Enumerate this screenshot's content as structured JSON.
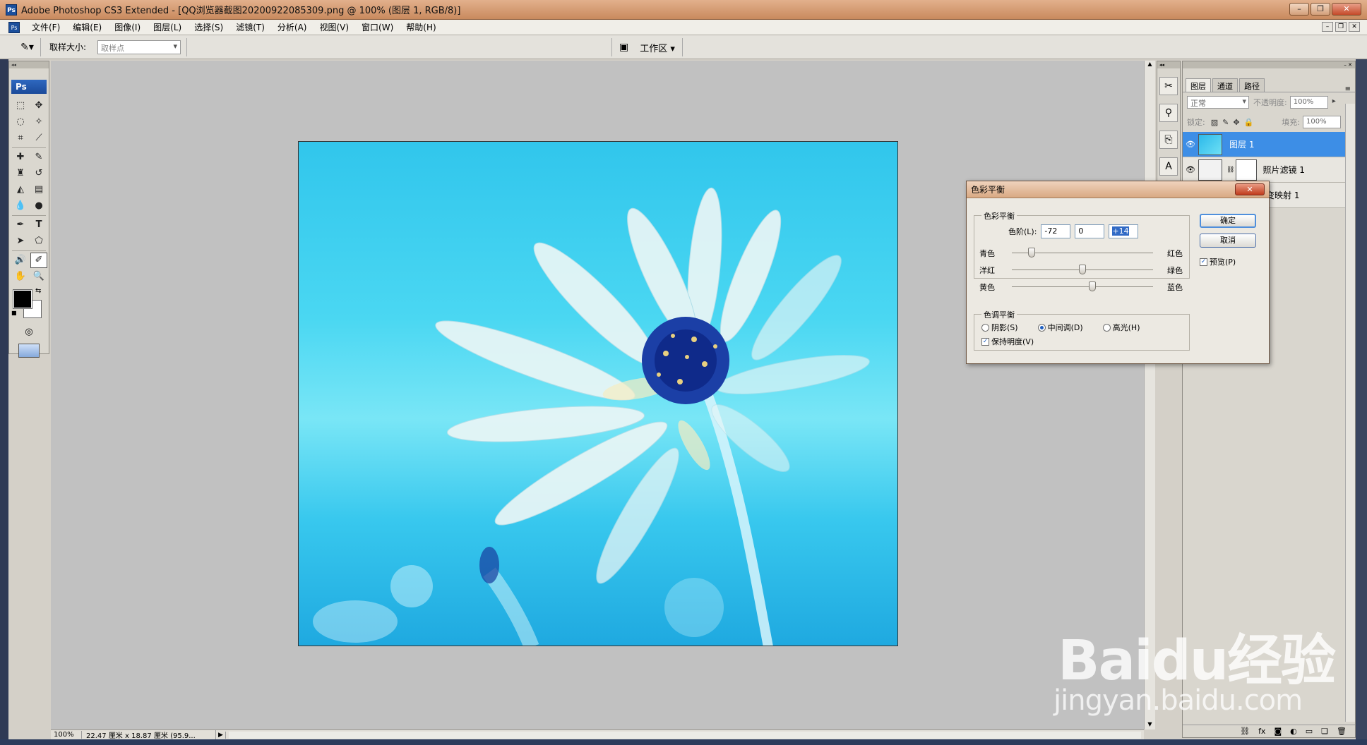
{
  "window": {
    "title": "Adobe Photoshop CS3 Extended - [QQ浏览器截图20200922085309.png @ 100% (图层 1, RGB/8)]",
    "app_icon": "Ps"
  },
  "menu": [
    "文件(F)",
    "编辑(E)",
    "图像(I)",
    "图层(L)",
    "选择(S)",
    "滤镜(T)",
    "分析(A)",
    "视图(V)",
    "窗口(W)",
    "帮助(H)"
  ],
  "options": {
    "tool_icon": "eyedropper-icon",
    "sample_size_label": "取样大小:",
    "sample_size_value": "取样点",
    "workspace_label": "工作区 ▾"
  },
  "toolbox": {
    "logo": "Ps",
    "tools": [
      "marquee",
      "move",
      "lasso",
      "magic-wand",
      "crop",
      "slice",
      "healing-brush",
      "brush",
      "clone-stamp",
      "history-brush",
      "eraser",
      "gradient",
      "blur",
      "dodge",
      "pen",
      "type",
      "path-selection",
      "shape",
      "notes",
      "eyedropper",
      "hand",
      "zoom"
    ]
  },
  "status": {
    "zoom": "100%",
    "doc_info": "22.47 厘米 x 18.87 厘米 (95.9..."
  },
  "layers_panel": {
    "tabs": [
      "图层",
      "通道",
      "路径"
    ],
    "blend_mode": "正常",
    "opacity_label": "不透明度:",
    "opacity_value": "100%",
    "lock_label": "锁定:",
    "fill_label": "填充:",
    "fill_value": "100%",
    "layers": [
      {
        "name": "图层 1",
        "selected": true
      },
      {
        "name": "照片滤镜 1",
        "selected": false
      },
      {
        "name": "变映射 1",
        "selected": false
      }
    ]
  },
  "dialog": {
    "title": "色彩平衡",
    "group_balance": "色彩平衡",
    "levels_label": "色阶(L):",
    "levels": [
      "-72",
      "0",
      "+14"
    ],
    "sliders": [
      {
        "left": "青色",
        "right": "红色",
        "value": -72
      },
      {
        "left": "洋红",
        "right": "绿色",
        "value": 0
      },
      {
        "left": "黄色",
        "right": "蓝色",
        "value": 14
      }
    ],
    "group_tone": "色调平衡",
    "tones": [
      {
        "label": "阴影(S)",
        "selected": false
      },
      {
        "label": "中间调(D)",
        "selected": true
      },
      {
        "label": "高光(H)",
        "selected": false
      }
    ],
    "preserve_luminosity": "保持明度(V)",
    "ok": "确定",
    "cancel": "取消",
    "preview": "预览(P)"
  },
  "watermark": {
    "brand": "Baidu经验",
    "url": "jingyan.baidu.com"
  }
}
